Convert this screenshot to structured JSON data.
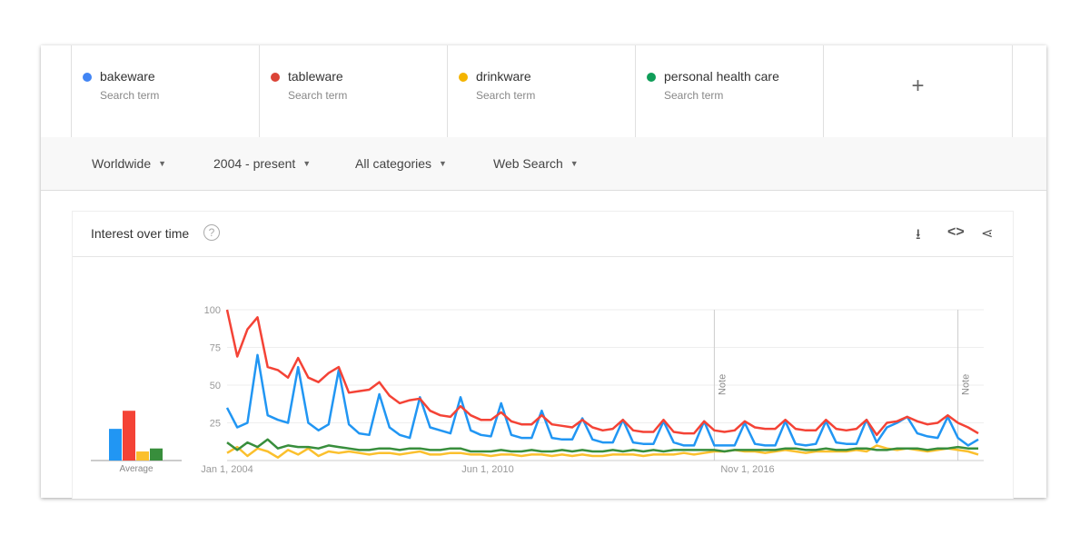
{
  "terms": [
    {
      "name": "bakeware",
      "sub": "Search term",
      "color": "#4285f4"
    },
    {
      "name": "tableware",
      "sub": "Search term",
      "color": "#db4437"
    },
    {
      "name": "drinkware",
      "sub": "Search term",
      "color": "#f4b400"
    },
    {
      "name": "personal health care",
      "sub": "Search term",
      "color": "#0f9d58"
    }
  ],
  "add_label": "+",
  "filters": {
    "region": "Worldwide",
    "time": "2004 - present",
    "category": "All categories",
    "search_type": "Web Search"
  },
  "panel": {
    "title": "Interest over time",
    "help": "?",
    "icons": [
      "download-icon",
      "embed-icon",
      "share-icon"
    ]
  },
  "chart_data": {
    "type": "line",
    "x_start": "2004-01",
    "x_step": "quarter",
    "yticks": [
      "100",
      "75",
      "50",
      "25"
    ],
    "ylim": [
      0,
      100
    ],
    "xtick_labels": [
      "Jan 1, 2004",
      "Jun 1, 2010",
      "Nov 1, 2016"
    ],
    "notes": [
      {
        "label": "Note",
        "date": "2016-01"
      },
      {
        "label": "Note",
        "date": "2022-01"
      }
    ],
    "average_label": "Average",
    "averages": [
      21,
      33,
      6,
      8
    ],
    "series": [
      {
        "name": "bakeware",
        "color": "#2196f3",
        "values": [
          35,
          22,
          25,
          70,
          30,
          27,
          25,
          62,
          25,
          20,
          24,
          60,
          24,
          18,
          17,
          44,
          22,
          17,
          15,
          42,
          22,
          20,
          18,
          42,
          20,
          17,
          16,
          38,
          17,
          15,
          15,
          33,
          15,
          14,
          14,
          28,
          14,
          12,
          12,
          27,
          12,
          11,
          11,
          26,
          12,
          10,
          10,
          26,
          10,
          10,
          10,
          25,
          11,
          10,
          10,
          26,
          11,
          10,
          11,
          26,
          12,
          11,
          11,
          27,
          12,
          22,
          25,
          29,
          18,
          16,
          15,
          29,
          15,
          10,
          14
        ]
      },
      {
        "name": "tableware",
        "color": "#f44336",
        "values": [
          100,
          69,
          87,
          95,
          62,
          60,
          55,
          68,
          55,
          52,
          58,
          62,
          45,
          46,
          47,
          52,
          43,
          38,
          40,
          41,
          33,
          30,
          29,
          36,
          30,
          27,
          27,
          32,
          26,
          24,
          24,
          30,
          24,
          23,
          22,
          27,
          22,
          20,
          21,
          27,
          20,
          19,
          19,
          27,
          19,
          18,
          18,
          26,
          20,
          19,
          20,
          26,
          22,
          21,
          21,
          27,
          21,
          20,
          20,
          27,
          21,
          20,
          21,
          27,
          17,
          25,
          26,
          29,
          26,
          24,
          25,
          30,
          25,
          22,
          18
        ]
      },
      {
        "name": "drinkware",
        "color": "#fbc02d",
        "values": [
          5,
          9,
          3,
          8,
          6,
          2,
          7,
          4,
          8,
          3,
          6,
          5,
          6,
          5,
          4,
          5,
          5,
          4,
          5,
          6,
          4,
          4,
          5,
          5,
          4,
          4,
          3,
          4,
          4,
          3,
          4,
          4,
          3,
          4,
          3,
          4,
          3,
          3,
          4,
          4,
          4,
          3,
          4,
          4,
          4,
          5,
          4,
          5,
          6,
          6,
          7,
          6,
          6,
          5,
          6,
          7,
          6,
          5,
          6,
          6,
          6,
          6,
          7,
          6,
          10,
          8,
          7,
          8,
          7,
          6,
          7,
          8,
          7,
          6,
          4
        ]
      },
      {
        "name": "personal health care",
        "color": "#388e3c",
        "values": [
          12,
          7,
          12,
          9,
          14,
          8,
          10,
          9,
          9,
          8,
          10,
          9,
          8,
          7,
          7,
          8,
          8,
          7,
          8,
          8,
          7,
          7,
          8,
          8,
          6,
          6,
          6,
          7,
          6,
          6,
          7,
          6,
          6,
          7,
          6,
          7,
          6,
          6,
          7,
          6,
          7,
          6,
          7,
          6,
          7,
          7,
          7,
          7,
          7,
          6,
          7,
          7,
          7,
          7,
          7,
          8,
          8,
          7,
          7,
          8,
          7,
          7,
          8,
          8,
          7,
          7,
          8,
          8,
          8,
          7,
          8,
          8,
          9,
          8,
          8
        ]
      }
    ]
  }
}
